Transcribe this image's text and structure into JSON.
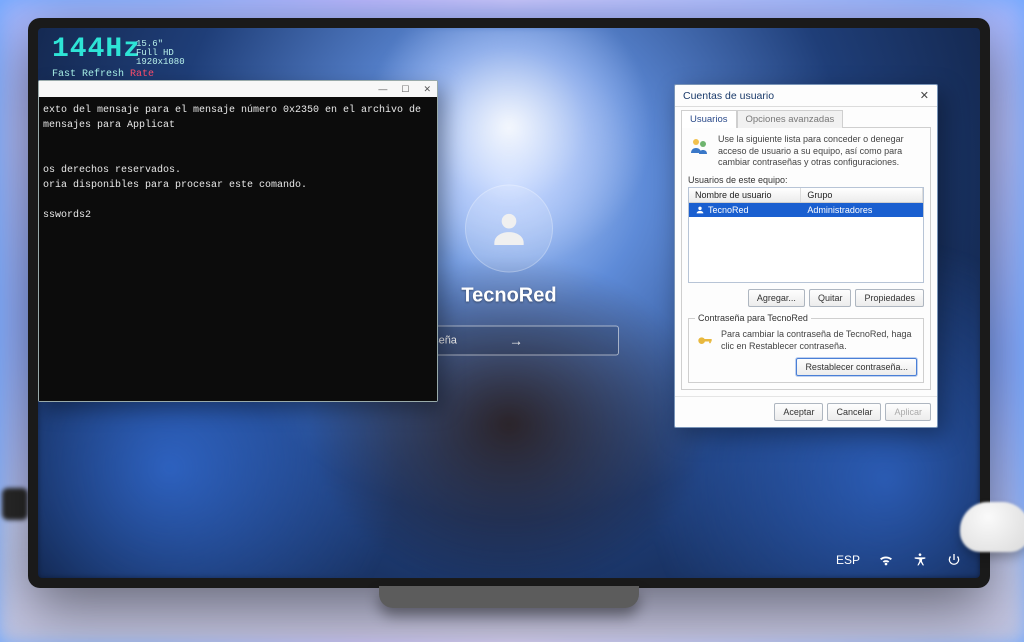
{
  "badge": {
    "hz": "144Hz",
    "spec": "15.6\" Full HD 1920x1080",
    "tag_prefix": "Fast Refresh ",
    "tag_accent": "Rate"
  },
  "lock": {
    "username": "TecnoRed",
    "password_placeholder": "ontraseña"
  },
  "tray": {
    "lang": "ESP"
  },
  "cmd": {
    "line1": "exto del mensaje para el mensaje número 0x2350 en el archivo de mensajes para Applicat",
    "line2": "os derechos reservados.",
    "line3": "oria disponibles para procesar este comando.",
    "line4": "sswords2"
  },
  "ua": {
    "title": "Cuentas de usuario",
    "tab_users": "Usuarios",
    "tab_advanced": "Opciones avanzadas",
    "desc": "Use la siguiente lista para conceder o denegar acceso de usuario a su equipo, así como para cambiar contraseñas y otras configuraciones.",
    "list_label": "Usuarios de este equipo:",
    "col_user": "Nombre de usuario",
    "col_group": "Grupo",
    "row_user": "TecnoRed",
    "row_group": "Administradores",
    "btn_add": "Agregar...",
    "btn_remove": "Quitar",
    "btn_props": "Propiedades",
    "fs_legend": "Contraseña para TecnoRed",
    "fs_text": "Para cambiar la contraseña de TecnoRed, haga clic en Restablecer contraseña.",
    "btn_reset": "Restablecer contraseña...",
    "btn_ok": "Aceptar",
    "btn_cancel": "Cancelar",
    "btn_apply": "Aplicar"
  }
}
